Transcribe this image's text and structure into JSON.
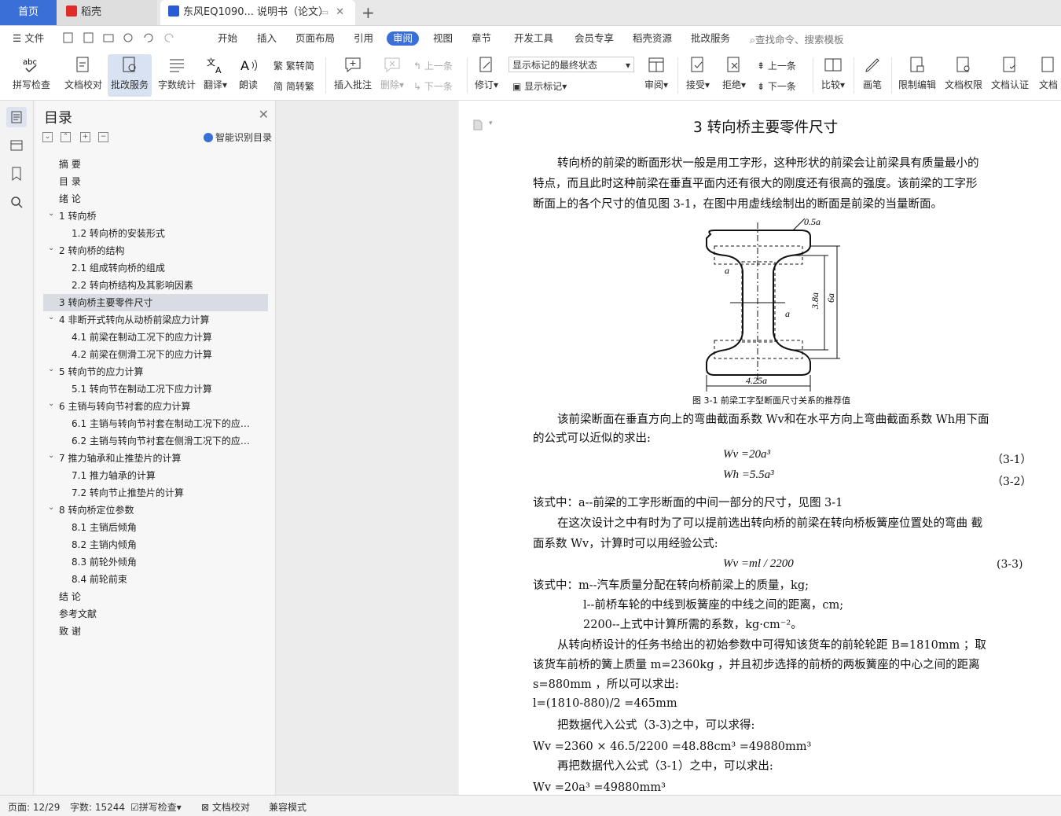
{
  "tabs": {
    "home": "首页",
    "daoke": "稻壳",
    "doc": "东风EQ1090... 说明书（论文）",
    "add": "+"
  },
  "menu": {
    "file": "文件",
    "items": [
      "开始",
      "插入",
      "页面布局",
      "引用",
      "审阅",
      "视图",
      "章节",
      "开发工具",
      "会员专享",
      "稻壳资源",
      "批改服务"
    ],
    "active": "审阅",
    "search": "查找命令、搜索模板"
  },
  "ribbon": {
    "spell": "拼写检查",
    "proof": "文档校对",
    "review_service": "批改服务",
    "wordcount": "字数统计",
    "translate": "翻译",
    "read": "朗读",
    "trad": "繁转简",
    "simp": "简转繁",
    "insert_comment": "插入批注",
    "delete": "删除",
    "prev": "上一条",
    "next": "下一条",
    "revise": "修订",
    "markup_select": "显示标记的最终状态",
    "show_markup": "显示标记",
    "review": "审阅",
    "accept": "接受",
    "reject": "拒绝",
    "prev2": "上一条",
    "next2": "下一条",
    "compare": "比较",
    "pen": "画笔",
    "restrict": "限制编辑",
    "permission": "文档权限",
    "certify": "文档认证",
    "more": "文档"
  },
  "toc": {
    "title": "目录",
    "smart": "智能识别目录",
    "items": [
      {
        "text": "摘 要",
        "level": 0,
        "chev": false
      },
      {
        "text": "目 录",
        "level": 0,
        "chev": false
      },
      {
        "text": "绪 论",
        "level": 0,
        "chev": false
      },
      {
        "text": "1  转向桥",
        "level": 0,
        "chev": true
      },
      {
        "text": "1.2  转向桥的安装形式",
        "level": 1,
        "chev": false
      },
      {
        "text": "2  转向桥的结构",
        "level": 0,
        "chev": true
      },
      {
        "text": "2.1  组成转向桥的组成",
        "level": 1,
        "chev": false
      },
      {
        "text": "2.2 转向桥结构及其影响因素",
        "level": 1,
        "chev": false
      },
      {
        "text": "3  转向桥主要零件尺寸",
        "level": 0,
        "chev": false,
        "selected": true
      },
      {
        "text": "4 非断开式转向从动桥前梁应力计算",
        "level": 0,
        "chev": true
      },
      {
        "text": "4.1 前梁在制动工况下的应力计算",
        "level": 1,
        "chev": false
      },
      {
        "text": "4.2 前梁在侧滑工况下的应力计算",
        "level": 1,
        "chev": false
      },
      {
        "text": "5  转向节的应力计算",
        "level": 0,
        "chev": true
      },
      {
        "text": "5.1 转向节在制动工况下应力计算",
        "level": 1,
        "chev": false
      },
      {
        "text": "6 主销与转向节衬套的应力计算",
        "level": 0,
        "chev": true
      },
      {
        "text": "6.1 主销与转向节衬套在制动工况下的应力 ...",
        "level": 1,
        "chev": false
      },
      {
        "text": "6.2 主销与转向节衬套在侧滑工况下的应力 ...",
        "level": 1,
        "chev": false
      },
      {
        "text": "7  推力轴承和止推垫片的计算",
        "level": 0,
        "chev": true
      },
      {
        "text": "7.1 推力轴承的计算",
        "level": 1,
        "chev": false
      },
      {
        "text": "7.2  转向节止推垫片的计算",
        "level": 1,
        "chev": false
      },
      {
        "text": "8 转向桥定位参数",
        "level": 0,
        "chev": true
      },
      {
        "text": "8.1  主销后倾角",
        "level": 1,
        "chev": false
      },
      {
        "text": "8.2  主销内倾角",
        "level": 1,
        "chev": false
      },
      {
        "text": "8.3  前轮外倾角",
        "level": 1,
        "chev": false
      },
      {
        "text": "8.4  前轮前束",
        "level": 1,
        "chev": false
      },
      {
        "text": "结 论",
        "level": 0,
        "chev": false
      },
      {
        "text": "参考文献",
        "level": 0,
        "chev": false
      },
      {
        "text": "致 谢",
        "level": 0,
        "chev": false
      }
    ]
  },
  "doc": {
    "heading": "3  转向桥主要零件尺寸",
    "p1a": "转向桥的前梁的断面形状一般是用工字形，这种形状的前梁会让前梁具有质量最小的",
    "p1b": "特点，而且此时这种前梁在垂直平面内还有很大的刚度还有很高的强度。该前梁的工字形",
    "p1c": "断面上的各个尺寸的值见图 3-1，在图中用虚线绘制出的断面是前梁的当量断面。",
    "fig_labels": {
      "t": "0.5a",
      "a1": "a",
      "h": "3.8a",
      "H": "6a",
      "a2": "a",
      "w": "4.25a"
    },
    "caption": "图 3-1  前梁工字型断面尺寸关系的推荐值",
    "p2a": "该前梁断面在垂直方向上的弯曲截面系数 Wv和在水平方向上弯曲截面系数 Wh用下面",
    "p2b": "的公式可以近似的求出:",
    "eq1": "Wv =20a³",
    "eq1n": "（3-1）",
    "eq2": "Wh =5.5a³",
    "eq2n": "（3-2）",
    "p3": "该式中：a--前梁的工字形断面的中间一部分的尺寸，见图 3-1",
    "p4a": "在这次设计之中有时为了可以提前选出转向桥的前梁在转向桥板簧座位置处的弯曲  截",
    "p4b": "面系数 Wv，计算时可以用经验公式:",
    "eq3": "Wv =ml / 2200",
    "eq3n": "(3-3)",
    "p5": "该式中：m--汽车质量分配在转向桥前梁上的质量，kg;",
    "p6": "l--前桥车轮的中线到板簧座的中线之间的距离，cm;",
    "p7": "2200--上式中计算所需的系数，kg·cm⁻²。",
    "p8a": "从转向桥设计的任务书给出的初始参数中可得知该货车的前轮轮距  B=1810mm ；取",
    "p8b": "该货车前桥的簧上质量  m=2360kg ，并且初步选择的前桥的两板簧座的中心之间的距离",
    "p8c": "s=880mm  ，所以可以求出:",
    "p9": "l=(1810-880)/2 =465mm",
    "p10": "把数据代入公式（3-3)之中，可以求得:",
    "p11": "Wv =2360 × 46.5/2200 =48.88cm³ =49880mm³",
    "p12": "再把数据代入公式（3-1）之中，可以求出:",
    "p13": "Wv =20a³ =49880mm³"
  },
  "status": {
    "page": "页面: 12/29",
    "words": "字数: 15244",
    "spell": "拼写检查",
    "proof": "文档校对",
    "compat": "兼容模式"
  }
}
